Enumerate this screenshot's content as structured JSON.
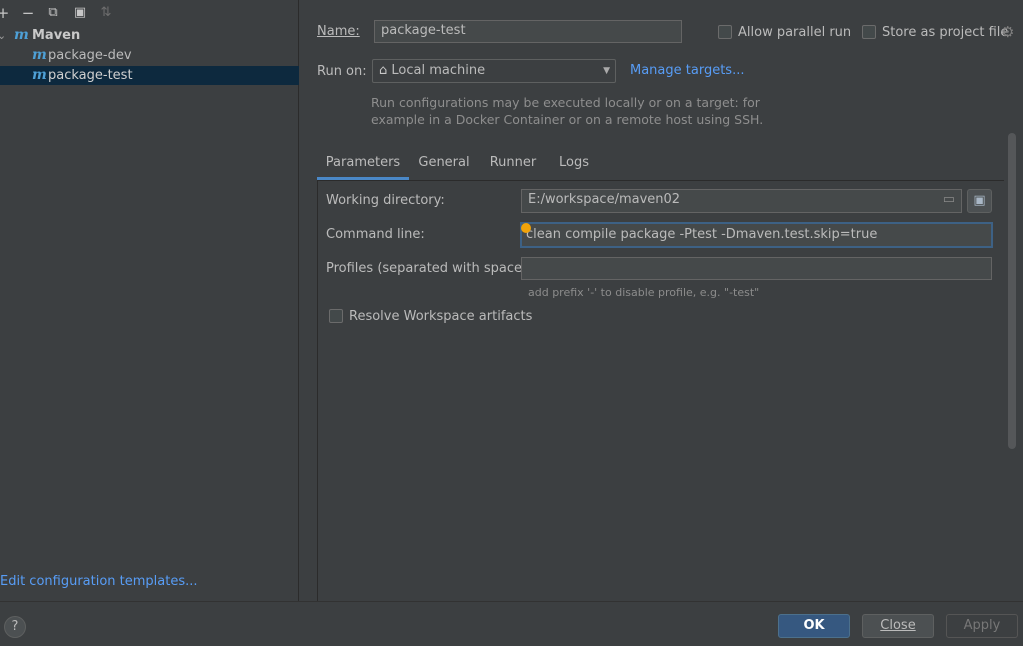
{
  "toolbar": {
    "add": "+",
    "remove": "−",
    "copy": "⧉",
    "folder": "▣",
    "sort": "⇅"
  },
  "tree": {
    "root_arrow": "⌄",
    "root_icon": "m",
    "root_label": "Maven",
    "items": [
      {
        "icon": "m",
        "label": "package-dev"
      },
      {
        "icon": "m",
        "label": "package-test"
      }
    ]
  },
  "edit_templates_link": "Edit configuration templates...",
  "form": {
    "name_label": "Name:",
    "name_value": "package-test",
    "allow_parallel_label": "Allow parallel run",
    "store_project_label": "Store as project file",
    "run_on_label": "Run on:",
    "run_on_value": "Local machine",
    "manage_targets": "Manage targets...",
    "run_on_hint_line1": "Run configurations may be executed locally or on a target: for",
    "run_on_hint_line2": "example in a Docker Container or on a remote host using SSH."
  },
  "tabs": [
    "Parameters",
    "General",
    "Runner",
    "Logs"
  ],
  "parameters": {
    "working_dir_label": "Working directory:",
    "working_dir_value": "E:/workspace/maven02",
    "command_line_label": "Command line:",
    "command_line_value": "clean compile package -Ptest -Dmaven.test.skip=true",
    "profiles_label": "Profiles (separated with space):",
    "profiles_value": "",
    "profiles_hint": "add prefix '-' to disable profile, e.g. \"-test\"",
    "resolve_workspace_label": "Resolve Workspace artifacts"
  },
  "buttons": {
    "help": "?",
    "ok": "OK",
    "close": "Close",
    "apply": "Apply"
  },
  "colors": {
    "background": "#3c3f41",
    "selection": "#0d293e",
    "accent": "#589df6",
    "primary_button": "#365880",
    "warning_dot": "#f0a30a"
  }
}
